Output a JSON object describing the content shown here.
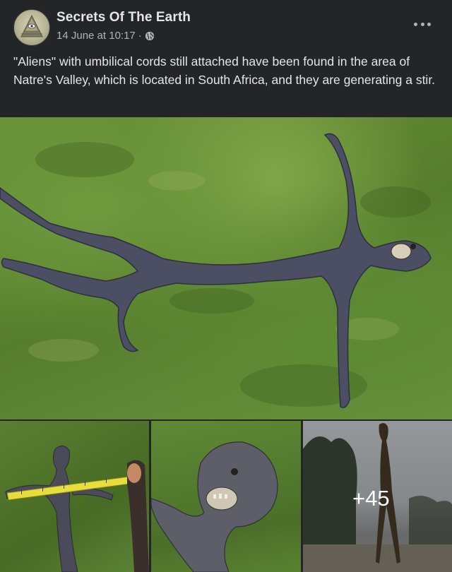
{
  "post": {
    "page_name": "Secrets Of The Earth",
    "timestamp": "14 June at 10:17",
    "separator": "·",
    "privacy_icon": "globe-icon",
    "options_icon": "more-options-icon",
    "text": "\"Aliens\" with umbilical cords still attached have been found in the area of Natre's Valley, which is located in South Africa, and they are generating a stir."
  },
  "gallery": {
    "more_photos_label": "+45"
  },
  "colors": {
    "background": "#242526",
    "primary_text": "#e4e6eb",
    "secondary_text": "#b0b3b8"
  }
}
